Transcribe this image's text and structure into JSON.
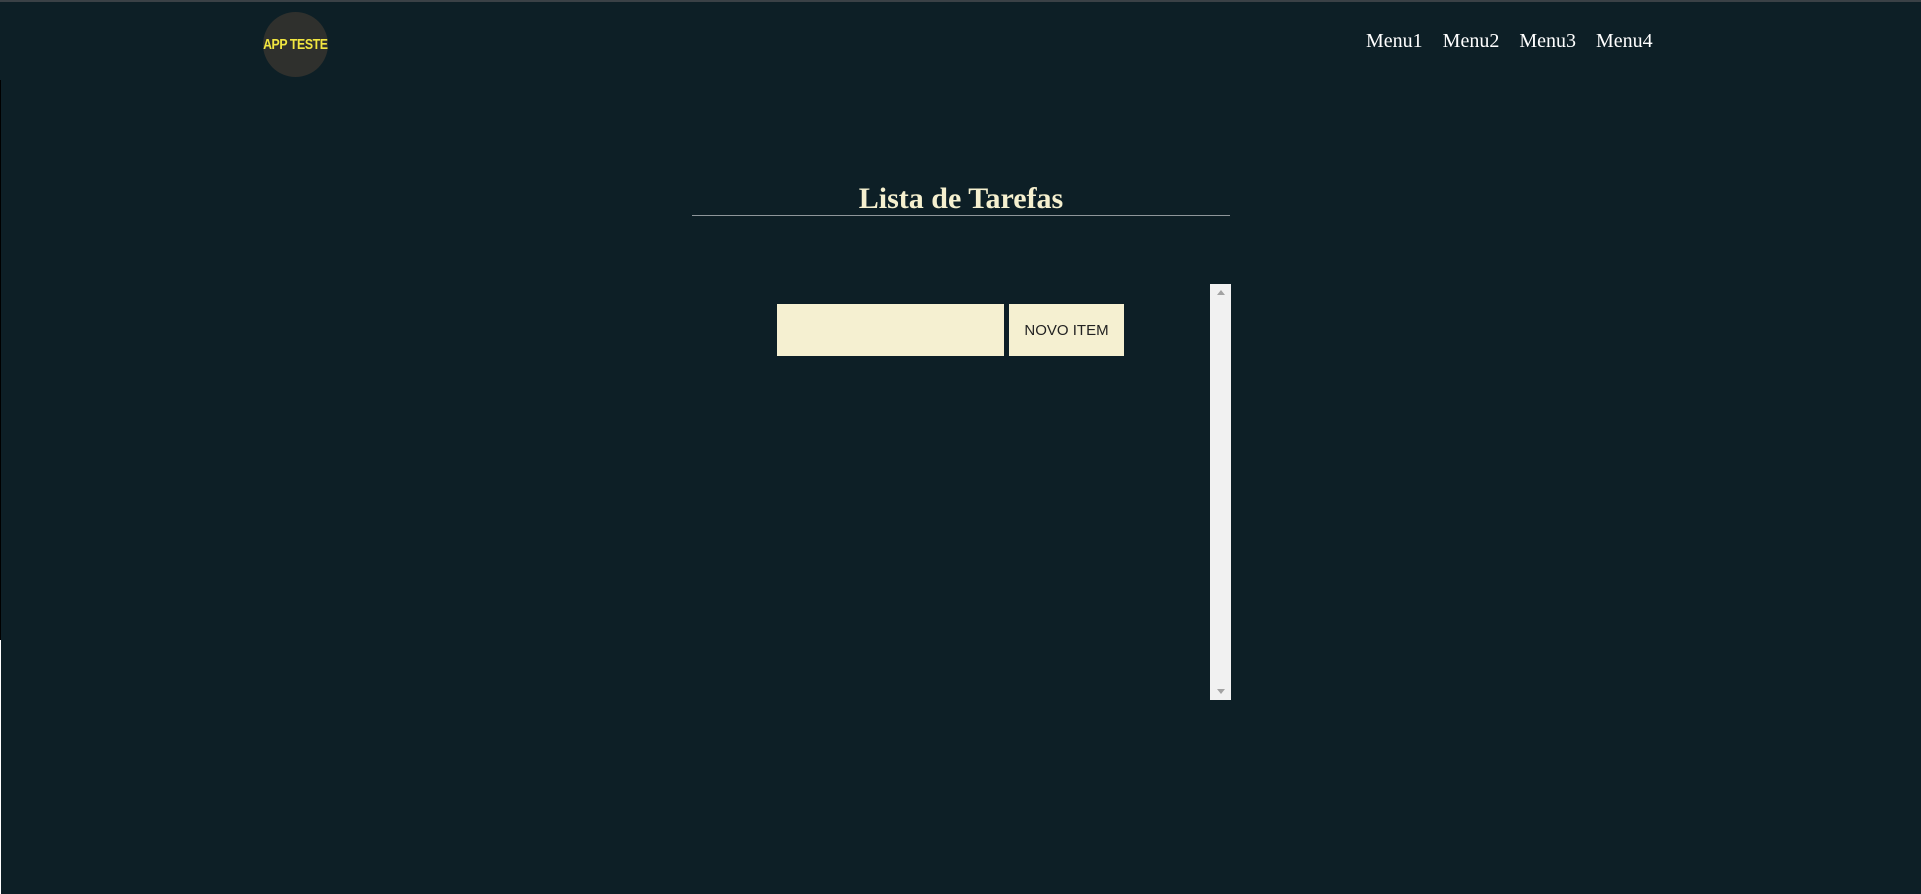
{
  "header": {
    "logo_text": "APP TESTE",
    "menu": [
      {
        "label": "Menu1"
      },
      {
        "label": "Menu2"
      },
      {
        "label": "Menu3"
      },
      {
        "label": "Menu4"
      }
    ]
  },
  "main": {
    "title": "Lista de Tarefas",
    "task_input": {
      "value": "",
      "placeholder": ""
    },
    "new_item_label": "NOVO ITEM"
  },
  "colors": {
    "background": "#0d1f26",
    "accent": "#f5f0d1",
    "logo_text": "#f2e640"
  },
  "icons": {
    "scroll_up": "triangle-up-icon",
    "scroll_down": "triangle-down-icon"
  }
}
